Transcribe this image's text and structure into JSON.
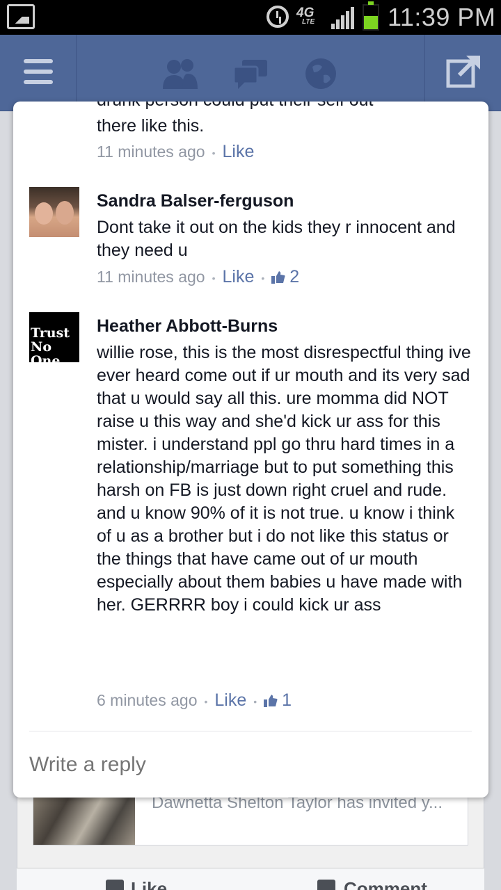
{
  "status_bar": {
    "time": "11:39 PM",
    "network": "4G",
    "network_sub": "LTE",
    "battery_level": 0.55
  },
  "app_bar": {
    "icons": [
      "menu-icon",
      "friends-icon",
      "messages-icon",
      "globe-icon",
      "share-icon"
    ],
    "accent_color": "#4e6798"
  },
  "background_feed": {
    "story_text": "Dawnetta Shelton Taylor has invited y...",
    "like_label": "Like",
    "comment_label": "Comment"
  },
  "comments": {
    "first_partial": {
      "text_cut": "drunk person could put their self out",
      "text_end": "there like this.",
      "time": "11 minutes ago",
      "like_label": "Like"
    },
    "sandra": {
      "name": "Sandra Balser-ferguson",
      "text": "Dont take it out on the kids they r innocent and they need u",
      "time": "11 minutes ago",
      "like_label": "Like",
      "likes": "2"
    },
    "heather": {
      "name": "Heather Abbott-Burns",
      "avatar_text": "Trust No One",
      "text": "willie rose, this is the most disrespectful thing ive ever heard come out if ur mouth and its very sad that u would say all this. ure momma did NOT raise u this way and she'd kick ur ass for this mister. i understand ppl go thru hard times in a relationship/marriage but to put something this harsh on FB is just down right cruel and rude. and u know 90% of it is not true. u know i think of u as a brother but i do not like this status or the things that have came out of ur mouth especially about them babies u have made with her. GERRRR boy i could kick ur ass",
      "time": "6 minutes ago",
      "like_label": "Like",
      "likes": "1"
    }
  },
  "reply": {
    "placeholder": "Write a reply"
  }
}
